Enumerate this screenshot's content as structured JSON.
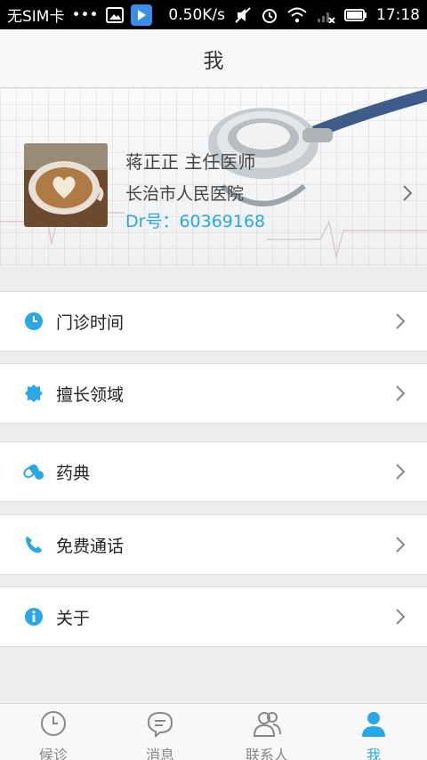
{
  "status_bar": {
    "carrier": "无SIM卡",
    "dots": "•••",
    "speed": "0.50K/s",
    "time": "17:18"
  },
  "header": {
    "title": "我"
  },
  "profile": {
    "name_title": "蒋正正 主任医师",
    "hospital": "长治市人民医院",
    "dr_number": "Dr号：60369168"
  },
  "menu": [
    {
      "label": "门诊时间",
      "icon": "clock-icon"
    },
    {
      "label": "擅长领域",
      "icon": "gear-badge-icon"
    },
    {
      "label": "药典",
      "icon": "pill-icon"
    },
    {
      "label": "免费通话",
      "icon": "phone-icon"
    },
    {
      "label": "关于",
      "icon": "info-icon"
    }
  ],
  "tabs": [
    {
      "label": "候诊",
      "icon": "clock-icon",
      "active": false
    },
    {
      "label": "消息",
      "icon": "chat-icon",
      "active": false
    },
    {
      "label": "联系人",
      "icon": "contacts-icon",
      "active": false
    },
    {
      "label": "我",
      "icon": "person-icon",
      "active": true
    }
  ],
  "colors": {
    "accent": "#2aa8e6",
    "tab_inactive": "#888888"
  }
}
